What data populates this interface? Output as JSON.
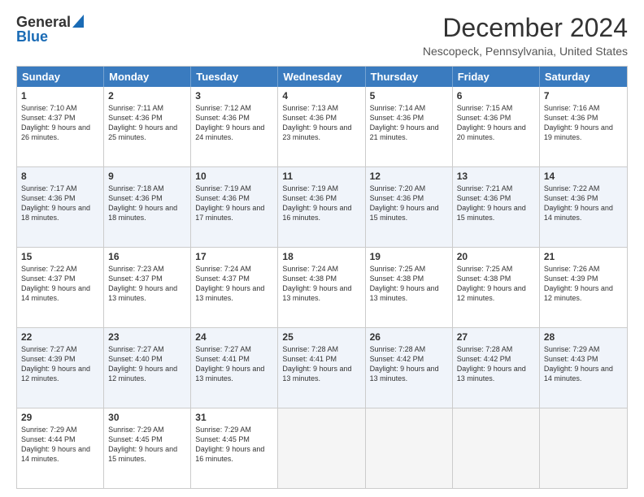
{
  "header": {
    "logo_general": "General",
    "logo_blue": "Blue",
    "main_title": "December 2024",
    "subtitle": "Nescopeck, Pennsylvania, United States"
  },
  "days_of_week": [
    "Sunday",
    "Monday",
    "Tuesday",
    "Wednesday",
    "Thursday",
    "Friday",
    "Saturday"
  ],
  "weeks": [
    [
      {
        "day": "1",
        "text": "Sunrise: 7:10 AM\nSunset: 4:37 PM\nDaylight: 9 hours and 26 minutes.",
        "alt": false
      },
      {
        "day": "2",
        "text": "Sunrise: 7:11 AM\nSunset: 4:36 PM\nDaylight: 9 hours and 25 minutes.",
        "alt": false
      },
      {
        "day": "3",
        "text": "Sunrise: 7:12 AM\nSunset: 4:36 PM\nDaylight: 9 hours and 24 minutes.",
        "alt": false
      },
      {
        "day": "4",
        "text": "Sunrise: 7:13 AM\nSunset: 4:36 PM\nDaylight: 9 hours and 23 minutes.",
        "alt": false
      },
      {
        "day": "5",
        "text": "Sunrise: 7:14 AM\nSunset: 4:36 PM\nDaylight: 9 hours and 21 minutes.",
        "alt": false
      },
      {
        "day": "6",
        "text": "Sunrise: 7:15 AM\nSunset: 4:36 PM\nDaylight: 9 hours and 20 minutes.",
        "alt": false
      },
      {
        "day": "7",
        "text": "Sunrise: 7:16 AM\nSunset: 4:36 PM\nDaylight: 9 hours and 19 minutes.",
        "alt": false
      }
    ],
    [
      {
        "day": "8",
        "text": "Sunrise: 7:17 AM\nSunset: 4:36 PM\nDaylight: 9 hours and 18 minutes.",
        "alt": true
      },
      {
        "day": "9",
        "text": "Sunrise: 7:18 AM\nSunset: 4:36 PM\nDaylight: 9 hours and 18 minutes.",
        "alt": true
      },
      {
        "day": "10",
        "text": "Sunrise: 7:19 AM\nSunset: 4:36 PM\nDaylight: 9 hours and 17 minutes.",
        "alt": true
      },
      {
        "day": "11",
        "text": "Sunrise: 7:19 AM\nSunset: 4:36 PM\nDaylight: 9 hours and 16 minutes.",
        "alt": true
      },
      {
        "day": "12",
        "text": "Sunrise: 7:20 AM\nSunset: 4:36 PM\nDaylight: 9 hours and 15 minutes.",
        "alt": true
      },
      {
        "day": "13",
        "text": "Sunrise: 7:21 AM\nSunset: 4:36 PM\nDaylight: 9 hours and 15 minutes.",
        "alt": true
      },
      {
        "day": "14",
        "text": "Sunrise: 7:22 AM\nSunset: 4:36 PM\nDaylight: 9 hours and 14 minutes.",
        "alt": true
      }
    ],
    [
      {
        "day": "15",
        "text": "Sunrise: 7:22 AM\nSunset: 4:37 PM\nDaylight: 9 hours and 14 minutes.",
        "alt": false
      },
      {
        "day": "16",
        "text": "Sunrise: 7:23 AM\nSunset: 4:37 PM\nDaylight: 9 hours and 13 minutes.",
        "alt": false
      },
      {
        "day": "17",
        "text": "Sunrise: 7:24 AM\nSunset: 4:37 PM\nDaylight: 9 hours and 13 minutes.",
        "alt": false
      },
      {
        "day": "18",
        "text": "Sunrise: 7:24 AM\nSunset: 4:38 PM\nDaylight: 9 hours and 13 minutes.",
        "alt": false
      },
      {
        "day": "19",
        "text": "Sunrise: 7:25 AM\nSunset: 4:38 PM\nDaylight: 9 hours and 13 minutes.",
        "alt": false
      },
      {
        "day": "20",
        "text": "Sunrise: 7:25 AM\nSunset: 4:38 PM\nDaylight: 9 hours and 12 minutes.",
        "alt": false
      },
      {
        "day": "21",
        "text": "Sunrise: 7:26 AM\nSunset: 4:39 PM\nDaylight: 9 hours and 12 minutes.",
        "alt": false
      }
    ],
    [
      {
        "day": "22",
        "text": "Sunrise: 7:27 AM\nSunset: 4:39 PM\nDaylight: 9 hours and 12 minutes.",
        "alt": true
      },
      {
        "day": "23",
        "text": "Sunrise: 7:27 AM\nSunset: 4:40 PM\nDaylight: 9 hours and 12 minutes.",
        "alt": true
      },
      {
        "day": "24",
        "text": "Sunrise: 7:27 AM\nSunset: 4:41 PM\nDaylight: 9 hours and 13 minutes.",
        "alt": true
      },
      {
        "day": "25",
        "text": "Sunrise: 7:28 AM\nSunset: 4:41 PM\nDaylight: 9 hours and 13 minutes.",
        "alt": true
      },
      {
        "day": "26",
        "text": "Sunrise: 7:28 AM\nSunset: 4:42 PM\nDaylight: 9 hours and 13 minutes.",
        "alt": true
      },
      {
        "day": "27",
        "text": "Sunrise: 7:28 AM\nSunset: 4:42 PM\nDaylight: 9 hours and 13 minutes.",
        "alt": true
      },
      {
        "day": "28",
        "text": "Sunrise: 7:29 AM\nSunset: 4:43 PM\nDaylight: 9 hours and 14 minutes.",
        "alt": true
      }
    ],
    [
      {
        "day": "29",
        "text": "Sunrise: 7:29 AM\nSunset: 4:44 PM\nDaylight: 9 hours and 14 minutes.",
        "alt": false
      },
      {
        "day": "30",
        "text": "Sunrise: 7:29 AM\nSunset: 4:45 PM\nDaylight: 9 hours and 15 minutes.",
        "alt": false
      },
      {
        "day": "31",
        "text": "Sunrise: 7:29 AM\nSunset: 4:45 PM\nDaylight: 9 hours and 16 minutes.",
        "alt": false
      },
      {
        "day": "",
        "text": "",
        "alt": false,
        "empty": true
      },
      {
        "day": "",
        "text": "",
        "alt": false,
        "empty": true
      },
      {
        "day": "",
        "text": "",
        "alt": false,
        "empty": true
      },
      {
        "day": "",
        "text": "",
        "alt": false,
        "empty": true
      }
    ]
  ]
}
